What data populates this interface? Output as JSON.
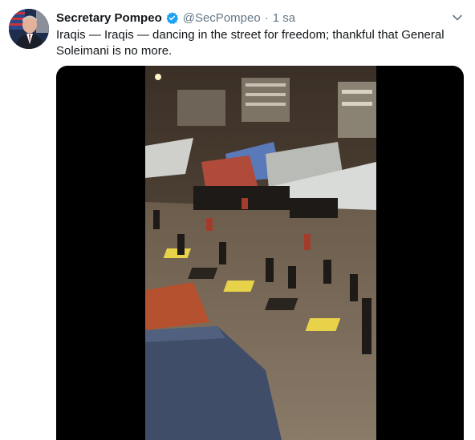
{
  "tweet": {
    "author_name": "Secretary Pompeo",
    "handle": "@SecPompeo",
    "separator": "·",
    "time": "1 sa",
    "text": "Iraqis — Iraqis — dancing in the street for freedom; thankful that General Soleimani is no more."
  },
  "icons": {
    "verified": "verified-badge-icon",
    "more": "chevron-down-icon"
  },
  "colors": {
    "name": "#14171a",
    "secondary": "#657786",
    "verified": "#1da1f2",
    "media_background": "#000000"
  }
}
